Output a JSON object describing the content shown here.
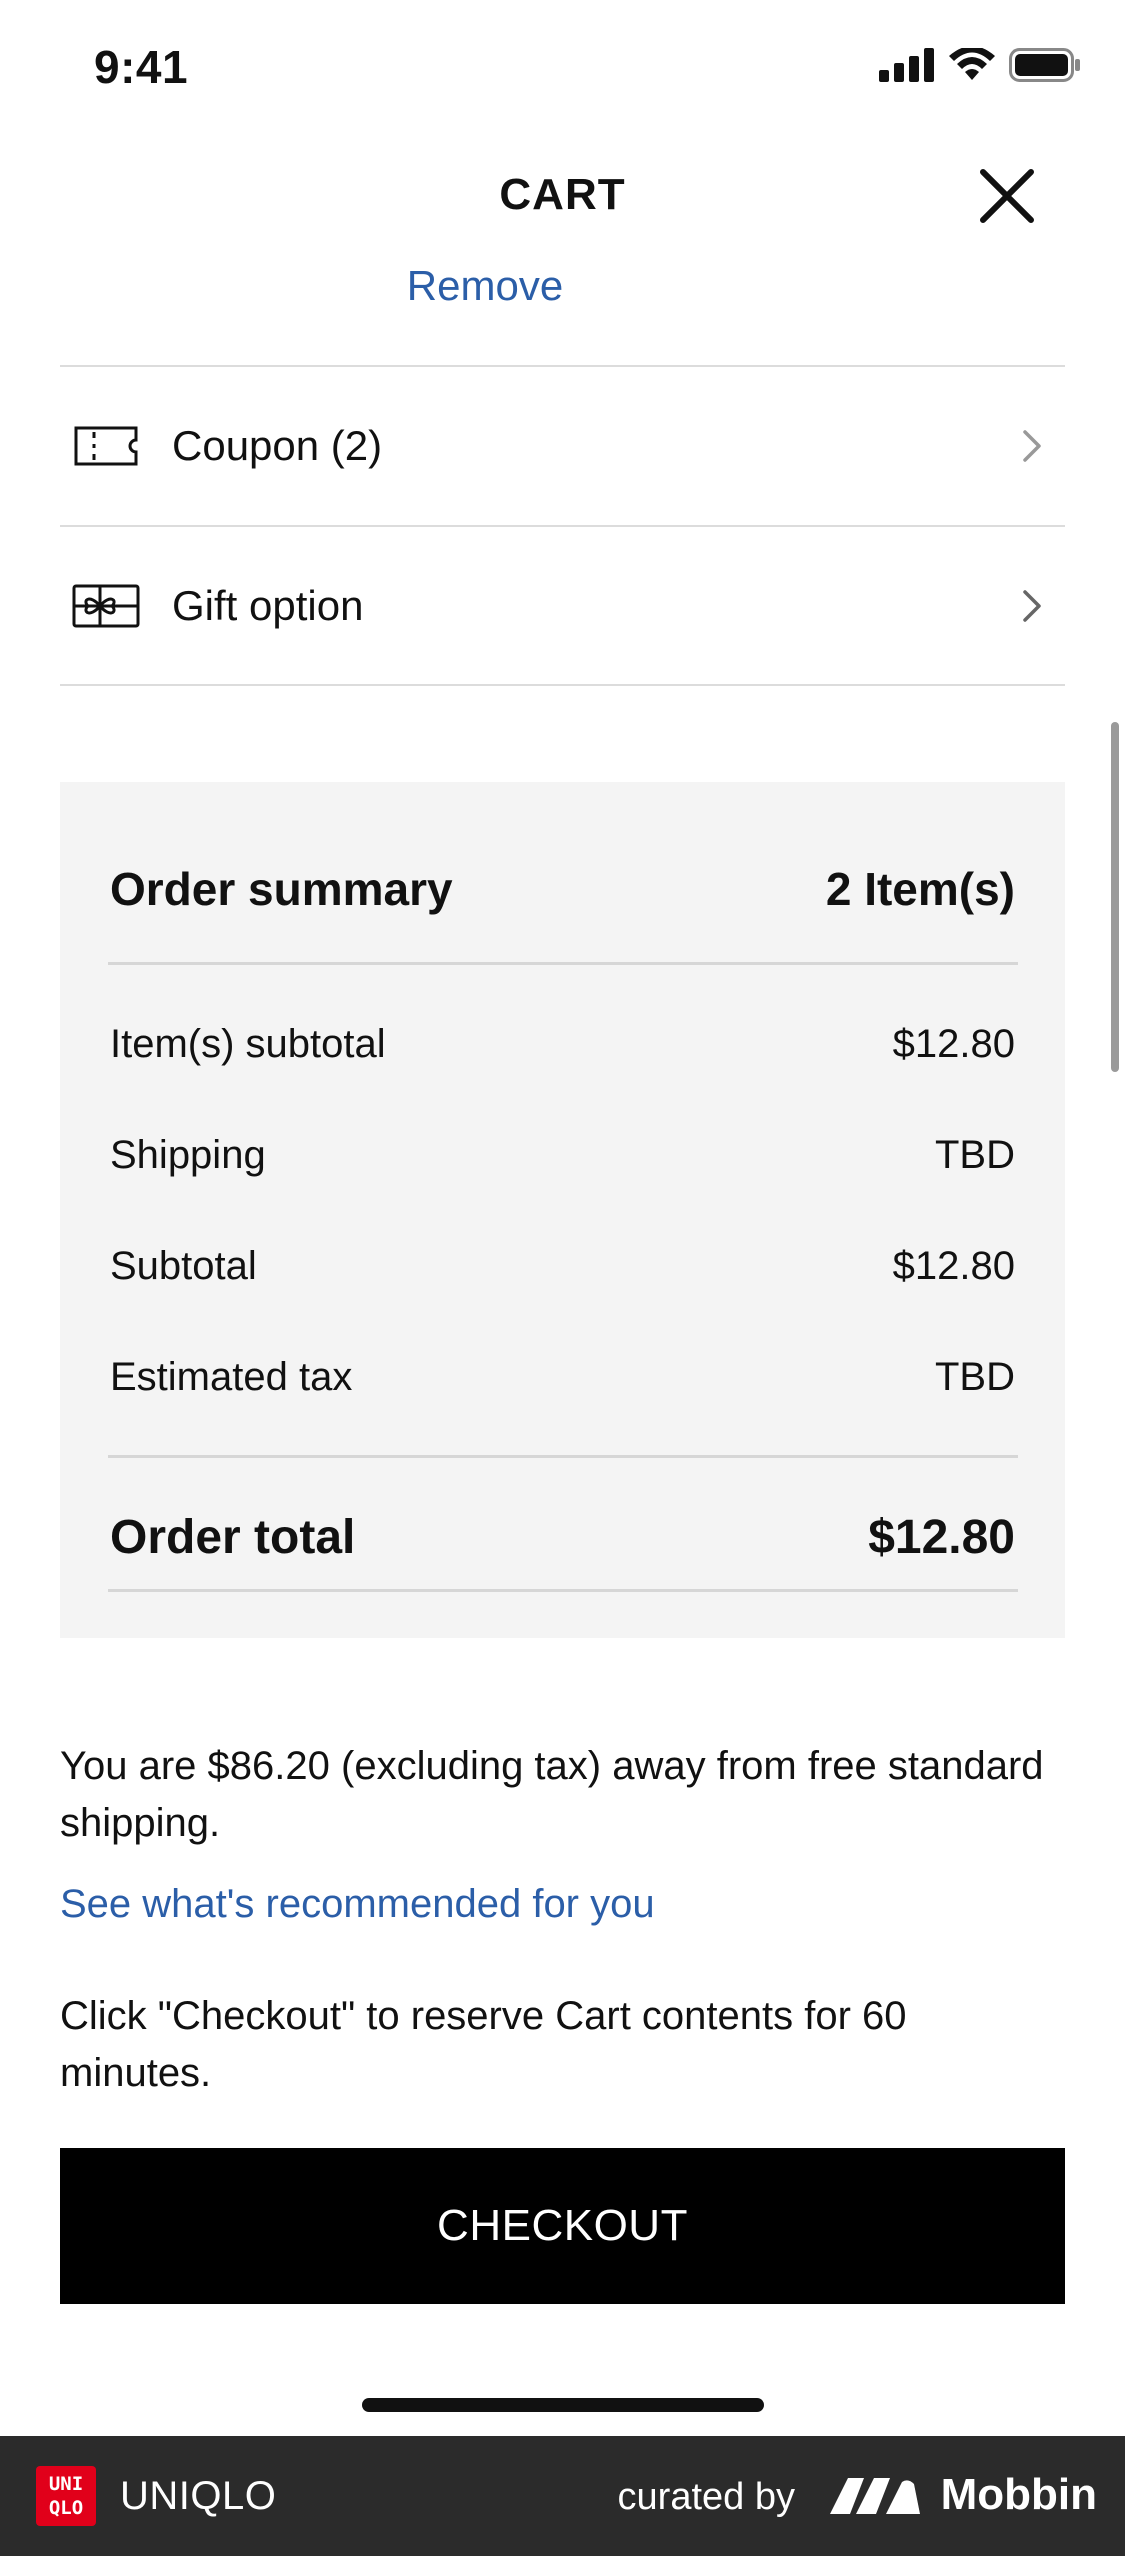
{
  "status_bar": {
    "time": "9:41"
  },
  "header": {
    "title": "CART"
  },
  "cart": {
    "remove_label": "Remove",
    "options": [
      {
        "label": "Coupon (2)",
        "icon": "coupon-icon"
      },
      {
        "label": "Gift option",
        "icon": "gift-icon"
      }
    ]
  },
  "summary": {
    "title": "Order summary",
    "item_count": "2 Item(s)",
    "rows": [
      {
        "label": "Item(s) subtotal",
        "value": "$12.80"
      },
      {
        "label": "Shipping",
        "value": "TBD"
      },
      {
        "label": "Subtotal",
        "value": "$12.80"
      },
      {
        "label": "Estimated tax",
        "value": "TBD"
      }
    ],
    "total_label": "Order total",
    "total_value": "$12.80"
  },
  "notices": {
    "free_shipping": "You are $86.20 (excluding tax) away from free standard shipping.",
    "recommend_link": "See what's recommended for you",
    "reserve": "Click \"Checkout\" to reserve Cart contents for 60 minutes."
  },
  "checkout_label": "CHECKOUT",
  "footer": {
    "logo_text": "UNI QLO",
    "brand": "UNIQLO",
    "curated_by": "curated by",
    "curator": "Mobbin"
  },
  "colors": {
    "link": "#2b5ea8",
    "button": "#000000",
    "summary_bg": "#f4f4f4",
    "footer_bg": "#2b2b2b",
    "brand_red": "#e1001a"
  }
}
